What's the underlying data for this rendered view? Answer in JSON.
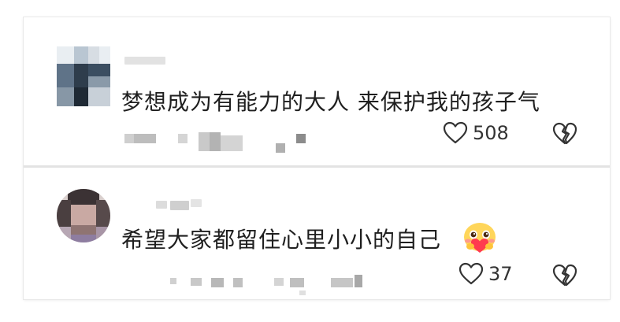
{
  "comments": [
    {
      "text": "梦想成为有能力的大人 来保护我的孩子气",
      "likes": "508"
    },
    {
      "text": "希望大家都留住心里小小的自己",
      "likes": "37",
      "emoji_icon": "blushing-heart-hug-emoji-icon"
    }
  ],
  "icons": {
    "like": "heart-outline-icon",
    "dislike": "broken-heart-icon"
  },
  "colors": {
    "text": "#1f1f1f",
    "icon": "#333333",
    "divider": "#e3e3e3"
  }
}
